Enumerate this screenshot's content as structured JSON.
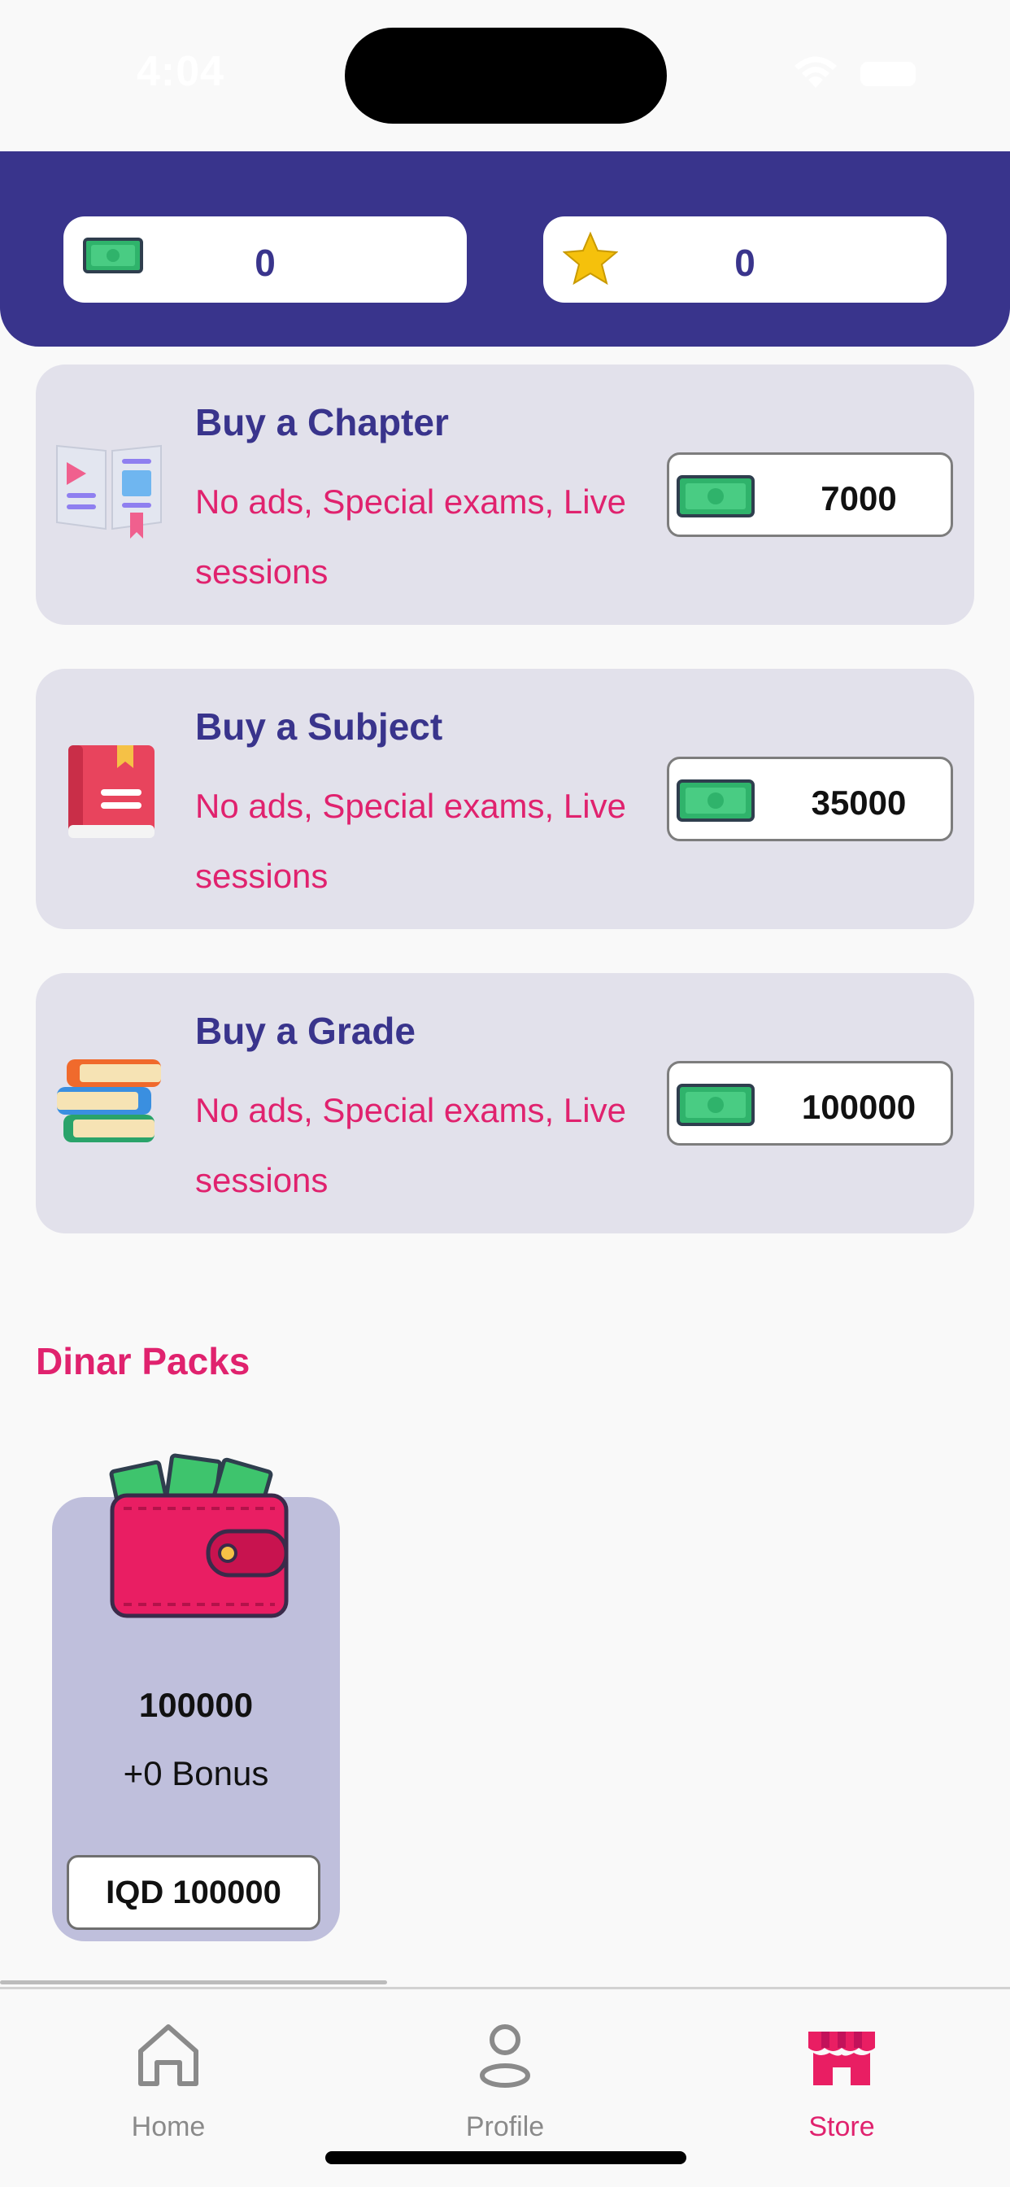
{
  "status_bar": {
    "time": "4:04"
  },
  "balances": {
    "cash": "0",
    "stars": "0"
  },
  "products": [
    {
      "title": "Buy a Chapter",
      "description": "No ads, Special exams, Live sessions",
      "price": "7000",
      "icon": "book-chapter-icon"
    },
    {
      "title": "Buy a Subject",
      "description": "No ads, Special exams, Live sessions",
      "price": "35000",
      "icon": "red-book-icon"
    },
    {
      "title": "Buy a Grade",
      "description": "No ads, Special exams, Live sessions",
      "price": "100000",
      "icon": "books-stack-icon"
    }
  ],
  "packs": {
    "section_title": "Dinar Packs",
    "items": [
      {
        "amount": "100000",
        "bonus": "+0 Bonus",
        "buy_label": "IQD 100000",
        "icon": "wallet-money-icon"
      }
    ]
  },
  "tabs": [
    {
      "label": "Home",
      "icon": "home-icon",
      "active": false
    },
    {
      "label": "Profile",
      "icon": "profile-icon",
      "active": false
    },
    {
      "label": "Store",
      "icon": "store-icon",
      "active": true
    }
  ],
  "colors": {
    "header_bg": "#39348c",
    "accent": "#e0226e",
    "card_bg": "#e2e1eb",
    "pack_bg": "#bfbfdc"
  }
}
